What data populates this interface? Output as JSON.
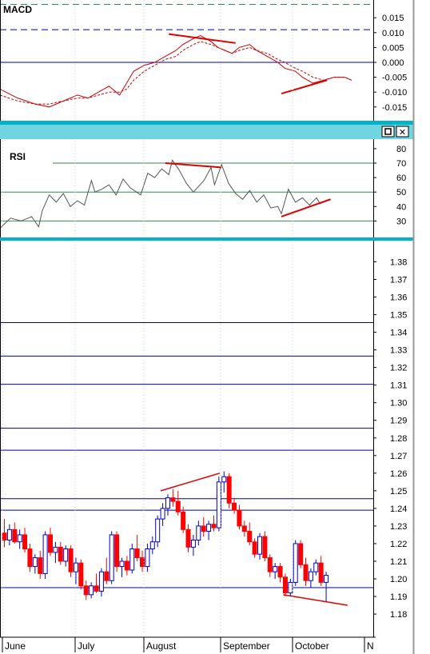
{
  "panels": {
    "macd": {
      "title": "MACD",
      "y_ticks": [
        "0.015",
        "0.010",
        "0.005",
        "0.000",
        "-0.005",
        "-0.010",
        "-0.015"
      ]
    },
    "rsi": {
      "title": "RSI",
      "y_ticks": [
        "80",
        "70",
        "60",
        "50",
        "40",
        "30"
      ]
    },
    "price": {
      "y_ticks": [
        "1.38",
        "1.37",
        "1.36",
        "1.35",
        "1.34",
        "1.33",
        "1.32",
        "1.31",
        "1.30",
        "1.29",
        "1.28",
        "1.27",
        "1.26",
        "1.25",
        "1.24",
        "1.23",
        "1.22",
        "1.21",
        "1.20",
        "1.19",
        "1.18"
      ]
    }
  },
  "window_buttons": {
    "restore": "□",
    "close": "✕"
  },
  "x_axis": {
    "labels": [
      "June",
      "July",
      "August",
      "September",
      "October",
      "N"
    ]
  },
  "colors": {
    "background": "#ffffff",
    "divider": "#00b3c8",
    "grid_blue": "#0000a0",
    "level_green": "#2e8b57",
    "up_candle": "#0000cc",
    "down_candle": "#ff0000",
    "macd_line": "#cc0000",
    "rsi_line": "#555555",
    "trend_red": "#e00000"
  },
  "chart_data": [
    {
      "type": "line",
      "panel": "MACD",
      "title": "MACD",
      "ylim": [
        -0.019,
        0.02
      ],
      "series": [
        {
          "style": "solid",
          "x": [
            0,
            5,
            10,
            14,
            18,
            22,
            25,
            28,
            31,
            34,
            36,
            38,
            41,
            44,
            47,
            50,
            52,
            55,
            57,
            60,
            62,
            64,
            66,
            68,
            71,
            73,
            76,
            79,
            81,
            84,
            86,
            89,
            92,
            95,
            98,
            100
          ],
          "values": [
            -0.009,
            -0.012,
            -0.014,
            -0.015,
            -0.013,
            -0.011,
            -0.012,
            -0.01,
            -0.008,
            -0.011,
            -0.007,
            -0.003,
            -0.001,
            0.0,
            0.002,
            0.004,
            0.006,
            0.008,
            0.009,
            0.007,
            0.005,
            0.004,
            0.003,
            0.005,
            0.006,
            0.004,
            0.002,
            0.0,
            -0.002,
            -0.003,
            -0.005,
            -0.007,
            -0.006,
            -0.005,
            -0.005,
            -0.006
          ]
        },
        {
          "style": "dashed",
          "x": [
            0,
            5,
            10,
            14,
            18,
            22,
            25,
            28,
            31,
            34,
            36,
            38,
            41,
            44,
            47,
            50,
            52,
            55,
            57,
            60,
            62,
            64,
            66,
            68,
            71,
            73,
            76,
            79,
            81,
            84,
            86,
            89,
            92,
            95,
            98,
            100
          ],
          "values": [
            -0.011,
            -0.013,
            -0.014,
            -0.014,
            -0.013,
            -0.012,
            -0.012,
            -0.011,
            -0.01,
            -0.01,
            -0.009,
            -0.006,
            -0.003,
            -0.001,
            0.001,
            0.002,
            0.004,
            0.006,
            0.007,
            0.006,
            0.005,
            0.004,
            0.003,
            0.004,
            0.005,
            0.004,
            0.003,
            0.001,
            0.0,
            -0.002,
            -0.003,
            -0.005,
            -0.006,
            -0.005,
            -0.005,
            -0.006
          ]
        }
      ],
      "trendlines": [
        {
          "x": [
            48,
            67
          ],
          "values": [
            0.0095,
            0.0065
          ]
        },
        {
          "x": [
            80,
            93
          ],
          "values": [
            -0.0105,
            -0.006
          ]
        }
      ],
      "hlines": [
        {
          "value": 0.0195,
          "style": "dashed-green"
        },
        {
          "value": 0.011,
          "style": "dashed-blue"
        },
        {
          "value": 0.0,
          "style": "solid-blue"
        }
      ]
    },
    {
      "type": "line",
      "panel": "RSI",
      "title": "RSI",
      "ylim": [
        12,
        83
      ],
      "series": [
        {
          "x": [
            0,
            3,
            6,
            9,
            11,
            12,
            14,
            16,
            18,
            20,
            22,
            24,
            26,
            27,
            29,
            31,
            33,
            35,
            37,
            40,
            42,
            44,
            46,
            48,
            49,
            51,
            53,
            55,
            58,
            60,
            61,
            63,
            65,
            67,
            69,
            71,
            73,
            75,
            77,
            79,
            80,
            82,
            84,
            86,
            88,
            90,
            91,
            93
          ],
          "values": [
            25,
            32,
            30,
            33,
            26,
            37,
            48,
            43,
            49,
            40,
            44,
            41,
            58,
            50,
            52,
            55,
            48,
            59,
            53,
            48,
            63,
            60,
            66,
            62,
            72,
            65,
            56,
            50,
            58,
            67,
            55,
            69,
            56,
            49,
            45,
            51,
            43,
            48,
            39,
            40,
            35,
            52,
            43,
            46,
            41,
            46,
            42,
            44
          ]
        }
      ],
      "trendlines": [
        {
          "x": [
            47,
            63
          ],
          "values": [
            70,
            67
          ]
        },
        {
          "x": [
            80,
            94
          ],
          "values": [
            33,
            45
          ]
        }
      ],
      "levels": [
        {
          "value": 70
        },
        {
          "value": 50
        },
        {
          "value": 30
        }
      ]
    },
    {
      "type": "candlestick",
      "panel": "Price",
      "ylim": [
        1.171,
        1.393
      ],
      "x_labels": [
        "June",
        "July",
        "August",
        "September",
        "October",
        "N"
      ],
      "candles": [
        {
          "o": 1.226,
          "h": 1.234,
          "l": 1.218,
          "c": 1.222
        },
        {
          "o": 1.222,
          "h": 1.231,
          "l": 1.219,
          "c": 1.228
        },
        {
          "o": 1.228,
          "h": 1.232,
          "l": 1.22,
          "c": 1.221
        },
        {
          "o": 1.221,
          "h": 1.228,
          "l": 1.217,
          "c": 1.225
        },
        {
          "o": 1.225,
          "h": 1.229,
          "l": 1.215,
          "c": 1.217
        },
        {
          "o": 1.217,
          "h": 1.22,
          "l": 1.204,
          "c": 1.207
        },
        {
          "o": 1.207,
          "h": 1.214,
          "l": 1.203,
          "c": 1.212
        },
        {
          "o": 1.212,
          "h": 1.216,
          "l": 1.2,
          "c": 1.203
        },
        {
          "o": 1.203,
          "h": 1.227,
          "l": 1.2,
          "c": 1.225
        },
        {
          "o": 1.225,
          "h": 1.229,
          "l": 1.213,
          "c": 1.215
        },
        {
          "o": 1.215,
          "h": 1.221,
          "l": 1.209,
          "c": 1.218
        },
        {
          "o": 1.218,
          "h": 1.221,
          "l": 1.208,
          "c": 1.21
        },
        {
          "o": 1.21,
          "h": 1.219,
          "l": 1.207,
          "c": 1.217
        },
        {
          "o": 1.217,
          "h": 1.219,
          "l": 1.201,
          "c": 1.204
        },
        {
          "o": 1.204,
          "h": 1.212,
          "l": 1.197,
          "c": 1.209
        },
        {
          "o": 1.209,
          "h": 1.211,
          "l": 1.194,
          "c": 1.196
        },
        {
          "o": 1.196,
          "h": 1.199,
          "l": 1.188,
          "c": 1.191
        },
        {
          "o": 1.191,
          "h": 1.198,
          "l": 1.189,
          "c": 1.196
        },
        {
          "o": 1.196,
          "h": 1.203,
          "l": 1.192,
          "c": 1.193
        },
        {
          "o": 1.193,
          "h": 1.206,
          "l": 1.19,
          "c": 1.204
        },
        {
          "o": 1.204,
          "h": 1.212,
          "l": 1.197,
          "c": 1.199
        },
        {
          "o": 1.199,
          "h": 1.227,
          "l": 1.197,
          "c": 1.225
        },
        {
          "o": 1.225,
          "h": 1.227,
          "l": 1.204,
          "c": 1.207
        },
        {
          "o": 1.207,
          "h": 1.212,
          "l": 1.201,
          "c": 1.21
        },
        {
          "o": 1.21,
          "h": 1.213,
          "l": 1.202,
          "c": 1.205
        },
        {
          "o": 1.205,
          "h": 1.22,
          "l": 1.203,
          "c": 1.217
        },
        {
          "o": 1.217,
          "h": 1.225,
          "l": 1.21,
          "c": 1.212
        },
        {
          "o": 1.212,
          "h": 1.216,
          "l": 1.204,
          "c": 1.207
        },
        {
          "o": 1.207,
          "h": 1.22,
          "l": 1.204,
          "c": 1.217
        },
        {
          "o": 1.217,
          "h": 1.224,
          "l": 1.214,
          "c": 1.221
        },
        {
          "o": 1.221,
          "h": 1.236,
          "l": 1.218,
          "c": 1.234
        },
        {
          "o": 1.234,
          "h": 1.243,
          "l": 1.23,
          "c": 1.24
        },
        {
          "o": 1.24,
          "h": 1.248,
          "l": 1.236,
          "c": 1.246
        },
        {
          "o": 1.246,
          "h": 1.251,
          "l": 1.241,
          "c": 1.244
        },
        {
          "o": 1.244,
          "h": 1.25,
          "l": 1.236,
          "c": 1.238
        },
        {
          "o": 1.238,
          "h": 1.241,
          "l": 1.226,
          "c": 1.228
        },
        {
          "o": 1.228,
          "h": 1.231,
          "l": 1.215,
          "c": 1.218
        },
        {
          "o": 1.218,
          "h": 1.225,
          "l": 1.213,
          "c": 1.222
        },
        {
          "o": 1.222,
          "h": 1.233,
          "l": 1.219,
          "c": 1.23
        },
        {
          "o": 1.23,
          "h": 1.235,
          "l": 1.224,
          "c": 1.227
        },
        {
          "o": 1.227,
          "h": 1.233,
          "l": 1.222,
          "c": 1.231
        },
        {
          "o": 1.231,
          "h": 1.236,
          "l": 1.227,
          "c": 1.229
        },
        {
          "o": 1.229,
          "h": 1.258,
          "l": 1.227,
          "c": 1.255
        },
        {
          "o": 1.255,
          "h": 1.261,
          "l": 1.249,
          "c": 1.258
        },
        {
          "o": 1.258,
          "h": 1.26,
          "l": 1.24,
          "c": 1.243
        },
        {
          "o": 1.243,
          "h": 1.246,
          "l": 1.237,
          "c": 1.239
        },
        {
          "o": 1.239,
          "h": 1.242,
          "l": 1.228,
          "c": 1.23
        },
        {
          "o": 1.23,
          "h": 1.233,
          "l": 1.224,
          "c": 1.227
        },
        {
          "o": 1.227,
          "h": 1.232,
          "l": 1.219,
          "c": 1.221
        },
        {
          "o": 1.221,
          "h": 1.223,
          "l": 1.212,
          "c": 1.214
        },
        {
          "o": 1.214,
          "h": 1.226,
          "l": 1.211,
          "c": 1.224
        },
        {
          "o": 1.224,
          "h": 1.227,
          "l": 1.21,
          "c": 1.212
        },
        {
          "o": 1.212,
          "h": 1.214,
          "l": 1.201,
          "c": 1.204
        },
        {
          "o": 1.204,
          "h": 1.209,
          "l": 1.2,
          "c": 1.207
        },
        {
          "o": 1.207,
          "h": 1.209,
          "l": 1.198,
          "c": 1.201
        },
        {
          "o": 1.201,
          "h": 1.203,
          "l": 1.19,
          "c": 1.192
        },
        {
          "o": 1.192,
          "h": 1.2,
          "l": 1.19,
          "c": 1.198
        },
        {
          "o": 1.198,
          "h": 1.222,
          "l": 1.196,
          "c": 1.22
        },
        {
          "o": 1.22,
          "h": 1.222,
          "l": 1.206,
          "c": 1.208
        },
        {
          "o": 1.208,
          "h": 1.212,
          "l": 1.196,
          "c": 1.199
        },
        {
          "o": 1.199,
          "h": 1.206,
          "l": 1.195,
          "c": 1.204
        },
        {
          "o": 1.204,
          "h": 1.211,
          "l": 1.202,
          "c": 1.209
        },
        {
          "o": 1.209,
          "h": 1.213,
          "l": 1.196,
          "c": 1.198
        },
        {
          "o": 1.198,
          "h": 1.204,
          "l": 1.187,
          "c": 1.202
        }
      ],
      "trendlines": [
        {
          "x": [
            31,
            41
          ],
          "values": [
            1.25,
            1.26
          ]
        },
        {
          "x": [
            55,
            66
          ],
          "values": [
            1.191,
            1.185
          ]
        }
      ],
      "hlines": [
        1.3455,
        1.3265,
        1.3105,
        1.2855,
        1.273,
        1.2455,
        1.239,
        1.195
      ]
    }
  ]
}
